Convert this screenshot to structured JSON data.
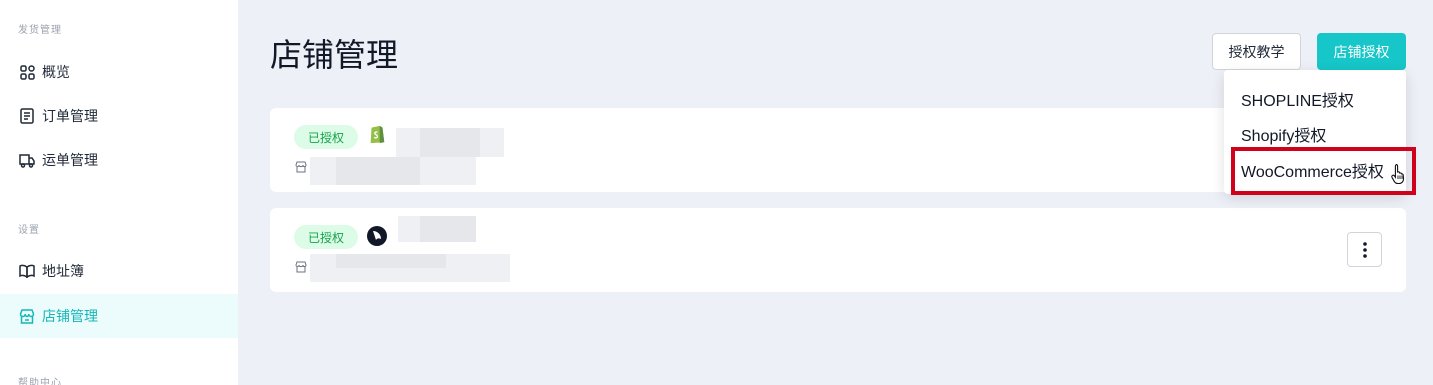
{
  "sidebar": {
    "sections": [
      {
        "title": "发货管理"
      },
      {
        "title": "设置"
      },
      {
        "title": "帮助中心"
      }
    ],
    "items": [
      {
        "label": "概览",
        "icon": "grid-icon"
      },
      {
        "label": "订单管理",
        "icon": "document-icon"
      },
      {
        "label": "运单管理",
        "icon": "truck-icon"
      },
      {
        "label": "地址簿",
        "icon": "book-icon"
      },
      {
        "label": "店铺管理",
        "icon": "store-icon",
        "active": true
      }
    ]
  },
  "header": {
    "title": "店铺管理",
    "tutorial_button": "授权教学",
    "authorize_button": "店铺授权"
  },
  "stores": [
    {
      "status": "已授权",
      "platform_icon": "shopify-icon"
    },
    {
      "status": "已授权",
      "platform_icon": "shopline-icon"
    }
  ],
  "dropdown": {
    "items": [
      "SHOPLINE授权",
      "Shopify授权",
      "WooCommerce授权"
    ]
  },
  "colors": {
    "accent": "#16c6c8",
    "badge_bg": "#dcfce7",
    "badge_text": "#16a34a",
    "highlight": "#d0021b"
  }
}
